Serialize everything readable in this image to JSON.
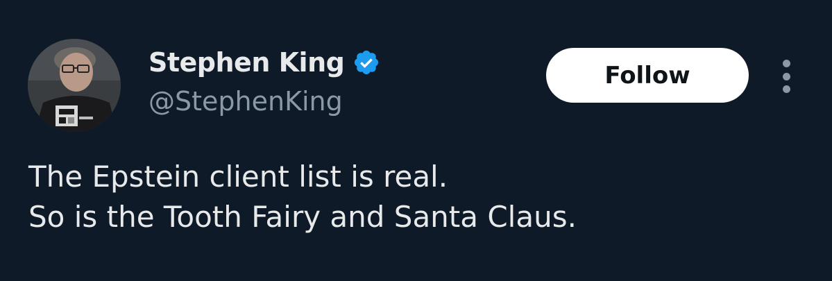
{
  "author": {
    "display_name": "Stephen King",
    "handle": "@StephenKing",
    "verified": true,
    "verified_color": "#1d9bf0"
  },
  "actions": {
    "follow_label": "Follow",
    "more_icon": "more-vertical-icon"
  },
  "tweet": {
    "lines": [
      "The Epstein client list is real.",
      "So is the Tooth Fairy and Santa Claus."
    ]
  },
  "colors": {
    "background": "#0f1a29",
    "primary_text": "#e7e9ea",
    "secondary_text": "#8b98a5",
    "follow_bg": "#ffffff"
  }
}
